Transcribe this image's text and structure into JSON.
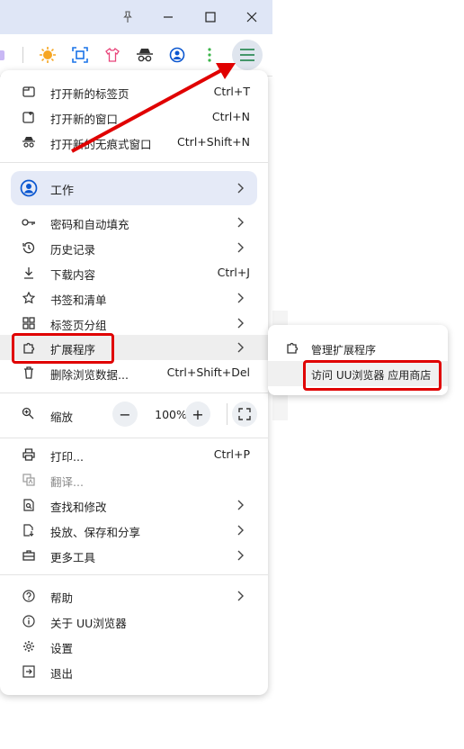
{
  "window": {
    "icons": [
      "pin-icon",
      "minimize-icon",
      "maximize-icon",
      "close-icon"
    ]
  },
  "toolbar": {
    "icons": [
      "puzzle-icon",
      "sun-icon",
      "screenshot-icon",
      "shirt-icon",
      "incognito-icon",
      "profile-icon",
      "more-icon",
      "menu-icon"
    ]
  },
  "menu": {
    "new_tab": {
      "label": "打开新的标签页",
      "shortcut": "Ctrl+T"
    },
    "new_window": {
      "label": "打开新的窗口",
      "shortcut": "Ctrl+N"
    },
    "new_incognito": {
      "label": "打开新的无痕式窗口",
      "shortcut": "Ctrl+Shift+N"
    },
    "profile": {
      "label": "工作"
    },
    "passwords": {
      "label": "密码和自动填充"
    },
    "history": {
      "label": "历史记录"
    },
    "downloads": {
      "label": "下载内容",
      "shortcut": "Ctrl+J"
    },
    "bookmarks": {
      "label": "书签和清单"
    },
    "tab_groups": {
      "label": "标签页分组"
    },
    "extensions": {
      "label": "扩展程序"
    },
    "clear_data": {
      "label": "删除浏览数据...",
      "shortcut": "Ctrl+Shift+Del"
    },
    "zoom": {
      "label": "缩放",
      "minus": "−",
      "value": "100%",
      "plus": "+"
    },
    "print": {
      "label": "打印...",
      "shortcut": "Ctrl+P"
    },
    "translate": {
      "label": "翻译..."
    },
    "find_edit": {
      "label": "查找和修改"
    },
    "cast_save_share": {
      "label": "投放、保存和分享"
    },
    "more_tools": {
      "label": "更多工具"
    },
    "help": {
      "label": "帮助"
    },
    "about": {
      "label": "关于 UU浏览器"
    },
    "settings": {
      "label": "设置"
    },
    "exit": {
      "label": "退出"
    }
  },
  "submenu": {
    "manage": {
      "label": "管理扩展程序"
    },
    "store": {
      "label": "访问 UU浏览器 应用商店"
    }
  },
  "colors": {
    "highlight": "#e00000",
    "accent": "#0b57d0",
    "menu_button": "#dfe5ee"
  }
}
